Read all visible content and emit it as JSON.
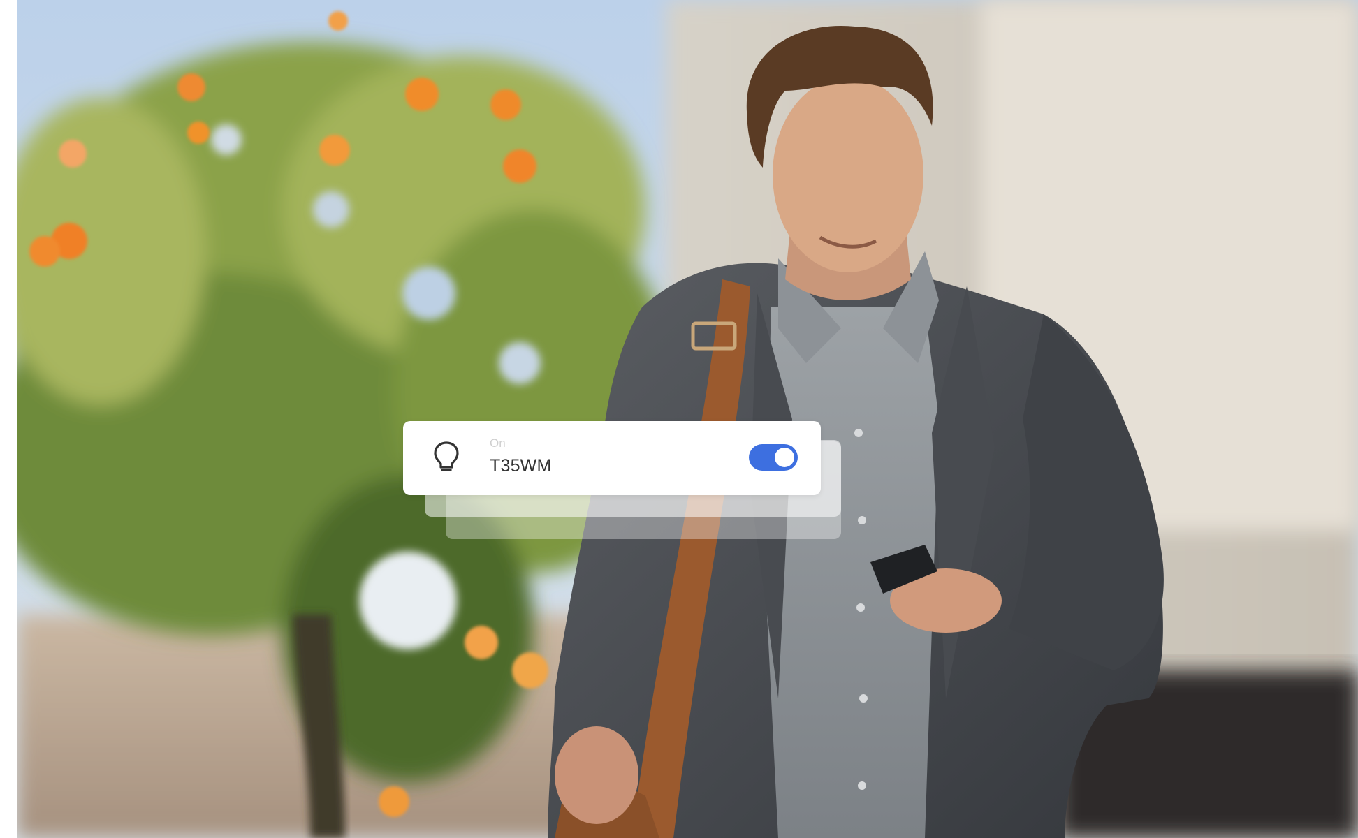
{
  "notification": {
    "status": "On",
    "device_name": "T35WM",
    "toggle_on": true,
    "icon": "lightbulb-icon"
  },
  "colors": {
    "toggle_accent": "#3d6fe0",
    "card_background": "#ffffff",
    "status_text": "#cfcfcf",
    "device_text": "#333333"
  }
}
